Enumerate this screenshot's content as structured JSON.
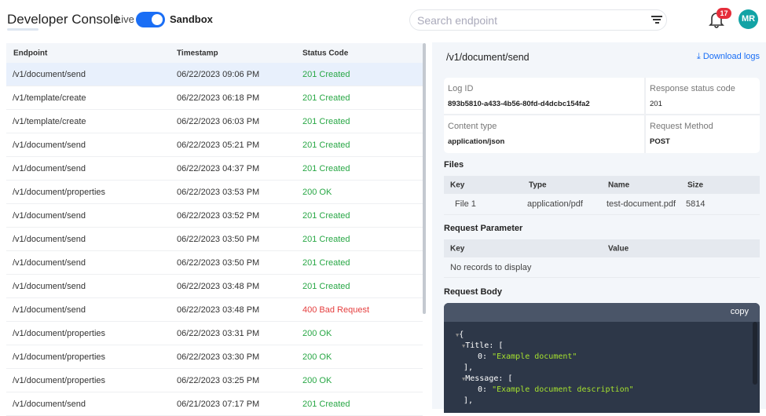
{
  "header": {
    "title": "Developer Console",
    "live_label": "Live",
    "sandbox_label": "Sandbox",
    "search_placeholder": "Search endpoint",
    "notification_count": "17",
    "avatar_initials": "MR"
  },
  "table": {
    "columns": [
      "Endpoint",
      "Timestamp",
      "Status Code"
    ],
    "rows": [
      {
        "endpoint": "/v1/document/send",
        "timestamp": "06/22/2023 09:06 PM",
        "status": "201 Created"
      },
      {
        "endpoint": "/v1/template/create",
        "timestamp": "06/22/2023 06:18 PM",
        "status": "201 Created"
      },
      {
        "endpoint": "/v1/template/create",
        "timestamp": "06/22/2023 06:03 PM",
        "status": "201 Created"
      },
      {
        "endpoint": "/v1/document/send",
        "timestamp": "06/22/2023 05:21 PM",
        "status": "201 Created"
      },
      {
        "endpoint": "/v1/document/send",
        "timestamp": "06/22/2023 04:37 PM",
        "status": "201 Created"
      },
      {
        "endpoint": "/v1/document/properties",
        "timestamp": "06/22/2023 03:53 PM",
        "status": "200 OK"
      },
      {
        "endpoint": "/v1/document/send",
        "timestamp": "06/22/2023 03:52 PM",
        "status": "201 Created"
      },
      {
        "endpoint": "/v1/document/send",
        "timestamp": "06/22/2023 03:50 PM",
        "status": "201 Created"
      },
      {
        "endpoint": "/v1/document/send",
        "timestamp": "06/22/2023 03:50 PM",
        "status": "201 Created"
      },
      {
        "endpoint": "/v1/document/send",
        "timestamp": "06/22/2023 03:48 PM",
        "status": "201 Created"
      },
      {
        "endpoint": "/v1/document/send",
        "timestamp": "06/22/2023 03:48 PM",
        "status": "400 Bad Request"
      },
      {
        "endpoint": "/v1/document/properties",
        "timestamp": "06/22/2023 03:31 PM",
        "status": "200 OK"
      },
      {
        "endpoint": "/v1/document/properties",
        "timestamp": "06/22/2023 03:30 PM",
        "status": "200 OK"
      },
      {
        "endpoint": "/v1/document/properties",
        "timestamp": "06/22/2023 03:25 PM",
        "status": "200 OK"
      },
      {
        "endpoint": "/v1/document/send",
        "timestamp": "06/21/2023 07:17 PM",
        "status": "201 Created"
      }
    ]
  },
  "detail": {
    "title": "/v1/document/send",
    "download_label": "Download logs",
    "log_id_label": "Log ID",
    "log_id": "893b5810-a433-4b56-80fd-d4dcbc154fa2",
    "status_label": "Response status code",
    "status": "201",
    "content_type_label": "Content type",
    "content_type": "application/json",
    "method_label": "Request Method",
    "method": "POST",
    "files_title": "Files",
    "files_columns": [
      "Key",
      "Type",
      "Name",
      "Size"
    ],
    "files_row": [
      "File 1",
      "application/pdf",
      "test-document.pdf",
      "5814"
    ],
    "params_title": "Request Parameter",
    "params_columns": [
      "Key",
      "Value"
    ],
    "params_empty": "No records to display",
    "body_title": "Request Body",
    "copy_label": "copy",
    "body_lines": [
      "{",
      "Title: [",
      "0: ",
      "\"Example document\"",
      "],",
      "Message: [",
      "0: ",
      "\"Example document description\"",
      "],"
    ]
  }
}
